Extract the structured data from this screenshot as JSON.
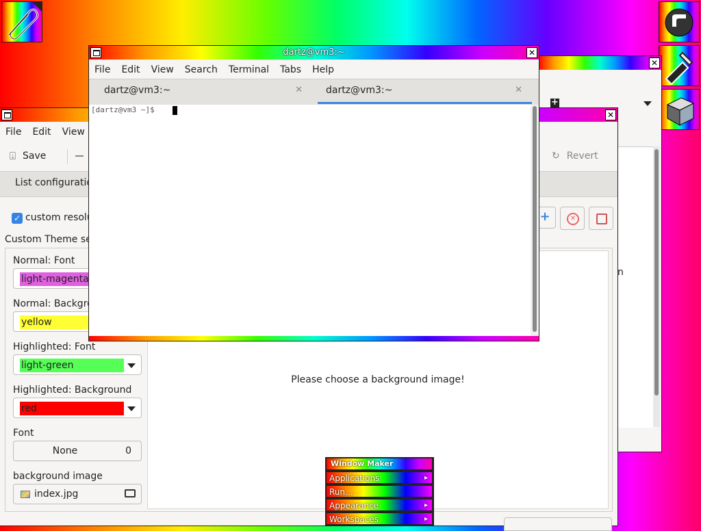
{
  "desktop": {
    "colors": {
      "accent": "#3584e4",
      "wm_border": "#222222"
    }
  },
  "terminal": {
    "title": "dartz@vm3:~",
    "menu": [
      "File",
      "Edit",
      "View",
      "Search",
      "Terminal",
      "Tabs",
      "Help"
    ],
    "tabs": [
      {
        "label": "dartz@vm3:~",
        "active": false
      },
      {
        "label": "dartz@vm3:~",
        "active": true
      }
    ],
    "prompt": "[dartz@vm3 ~]$"
  },
  "config_window": {
    "menu": [
      "File",
      "Edit",
      "View"
    ],
    "toolbar": {
      "save_label": "Save",
      "revert_label": "Revert"
    },
    "list_tab_label": "List configuration",
    "custom_checkbox_label": "custom resolu",
    "custom_checkbox_checked": true,
    "section_label": "Custom Theme set",
    "normal_font_label": "Normal: Font",
    "normal_font_value": "light-magenta",
    "normal_font_color": "#e060e0",
    "normal_bg_label": "Normal: Backgro",
    "normal_bg_value": "yellow",
    "normal_bg_color": "#ffff33",
    "hl_font_label": "Highlighted: Font",
    "hl_font_value": "light-green",
    "hl_font_color": "#55ff55",
    "hl_bg_label": "Highlighted: Background",
    "hl_bg_value": "red",
    "hl_bg_color": "#ff0000",
    "font_label": "Font",
    "font_value": "None",
    "font_size": "0",
    "bg_image_label": "background image",
    "bg_image_value": "index.jpg",
    "preview_message": "Please choose a background image!"
  },
  "back_window": {
    "partial_text": "n"
  },
  "wm_menu": {
    "title": "Window Maker",
    "items": [
      {
        "label": "Applications",
        "submenu": true
      },
      {
        "label": "Run...",
        "submenu": false
      },
      {
        "label": "Appearance",
        "submenu": true
      },
      {
        "label": "Workspaces",
        "submenu": true
      }
    ]
  }
}
